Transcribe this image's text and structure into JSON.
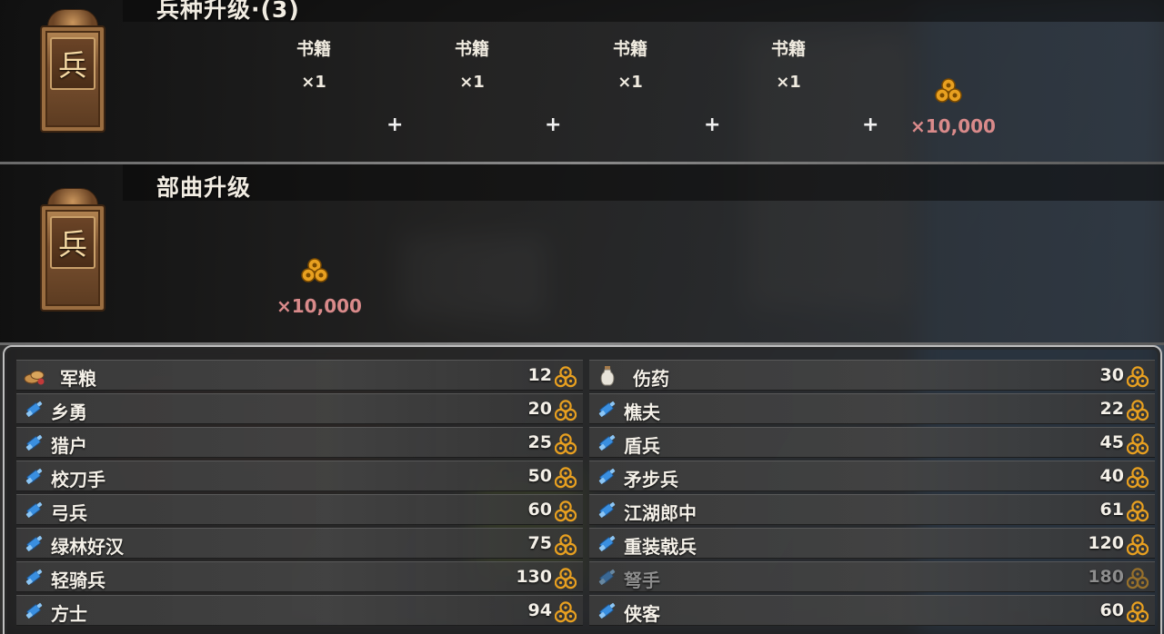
{
  "upgrade_unit": {
    "title": "兵种升级·(3)",
    "emblem": "兵",
    "requirements": [
      {
        "name": "书籍",
        "qty": "×1"
      },
      {
        "name": "书籍",
        "qty": "×1"
      },
      {
        "name": "书籍",
        "qty": "×1"
      },
      {
        "name": "书籍",
        "qty": "×1"
      }
    ],
    "plus": "+",
    "coin_cost": "×10,000"
  },
  "upgrade_troop": {
    "title": "部曲升级",
    "emblem": "兵",
    "coin_cost": "×10,000"
  },
  "shop": {
    "left": [
      {
        "icon": "food-sacks-icon",
        "label": "军粮",
        "price": "12"
      },
      {
        "icon": "scroll-icon",
        "label": "乡勇",
        "price": "20"
      },
      {
        "icon": "scroll-icon",
        "label": "猎户",
        "price": "25"
      },
      {
        "icon": "scroll-icon",
        "label": "校刀手",
        "price": "50"
      },
      {
        "icon": "scroll-icon",
        "label": "弓兵",
        "price": "60"
      },
      {
        "icon": "scroll-icon",
        "label": "绿林好汉",
        "price": "75"
      },
      {
        "icon": "scroll-icon",
        "label": "轻骑兵",
        "price": "130"
      },
      {
        "icon": "scroll-icon",
        "label": "方士",
        "price": "94"
      }
    ],
    "right": [
      {
        "icon": "medicine-jar-icon",
        "label": "伤药",
        "price": "30"
      },
      {
        "icon": "scroll-icon",
        "label": "樵夫",
        "price": "22"
      },
      {
        "icon": "scroll-icon",
        "label": "盾兵",
        "price": "45"
      },
      {
        "icon": "scroll-icon",
        "label": "矛步兵",
        "price": "40"
      },
      {
        "icon": "scroll-icon",
        "label": "江湖郎中",
        "price": "61"
      },
      {
        "icon": "scroll-icon",
        "label": "重装戟兵",
        "price": "120"
      },
      {
        "icon": "scroll-icon",
        "label": "弩手",
        "price": "180",
        "disabled": true
      },
      {
        "icon": "scroll-icon",
        "label": "侠客",
        "price": "60"
      }
    ]
  },
  "colors": {
    "coin": "#e8a020",
    "cost_red": "#d98a8a",
    "scroll_blue": "#3a8fe0",
    "disabled_text": "#8d8d8d"
  }
}
